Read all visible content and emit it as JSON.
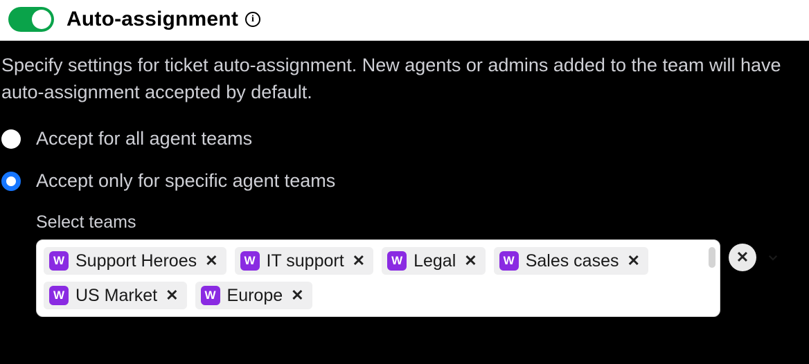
{
  "header": {
    "toggle_on": true,
    "title": "Auto-assignment",
    "info_glyph": "i"
  },
  "description": "Specify settings for ticket auto-assignment. New agents or admins added to the team will have auto-assignment accepted by default.",
  "options": {
    "all_teams": "Accept for all agent teams",
    "specific_teams": "Accept only for specific agent teams"
  },
  "selected_option": "specific_teams",
  "select_label": "Select teams",
  "chip_icon_letter": "W",
  "teams": [
    {
      "name": "Support Heroes"
    },
    {
      "name": "IT support"
    },
    {
      "name": "Legal"
    },
    {
      "name": "Sales cases"
    },
    {
      "name": "US Market"
    },
    {
      "name": "Europe"
    }
  ],
  "colors": {
    "toggle_on_bg": "#0aa34a",
    "radio_selected": "#1676ff",
    "chip_icon_bg": "#8a2be2"
  }
}
